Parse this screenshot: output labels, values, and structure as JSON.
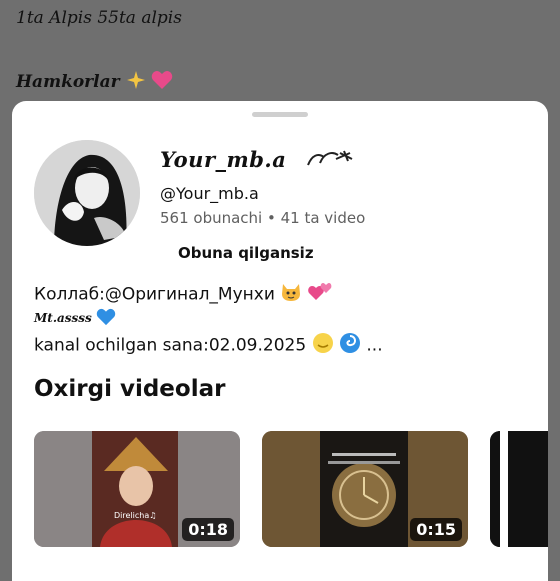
{
  "background": {
    "line1": "1ta Alpis  55ta alpis",
    "line2": "Hamkorlar"
  },
  "channel": {
    "name": "Your_mb.a",
    "handle": "@Your_mb.a",
    "stats": "561 obunachi • 41 ta video",
    "subscribe_label": "Obuna qilgansiz"
  },
  "description": {
    "line1": "Коллаб:@Оригинал_Мунхи",
    "line2": "Mt.assss",
    "line3": "kanal ochilgan sana:02.09.2025",
    "line3_more": "..."
  },
  "section": {
    "title": "Oxirgi videolar"
  },
  "videos": [
    {
      "duration": "0:18",
      "overlay_text": "Direlicha♫"
    },
    {
      "duration": "0:15"
    },
    {
      "duration": ""
    }
  ],
  "colors": {
    "accent_heart": "#e84a8a",
    "blue_heart": "#2f8fe3",
    "backdrop": "#6f6f6f"
  },
  "icons": [
    "sparkles-icon",
    "heart-icon",
    "cat-icon",
    "two-hearts-icon",
    "blue-heart-icon",
    "smile-moon-icon",
    "cyclone-icon"
  ]
}
